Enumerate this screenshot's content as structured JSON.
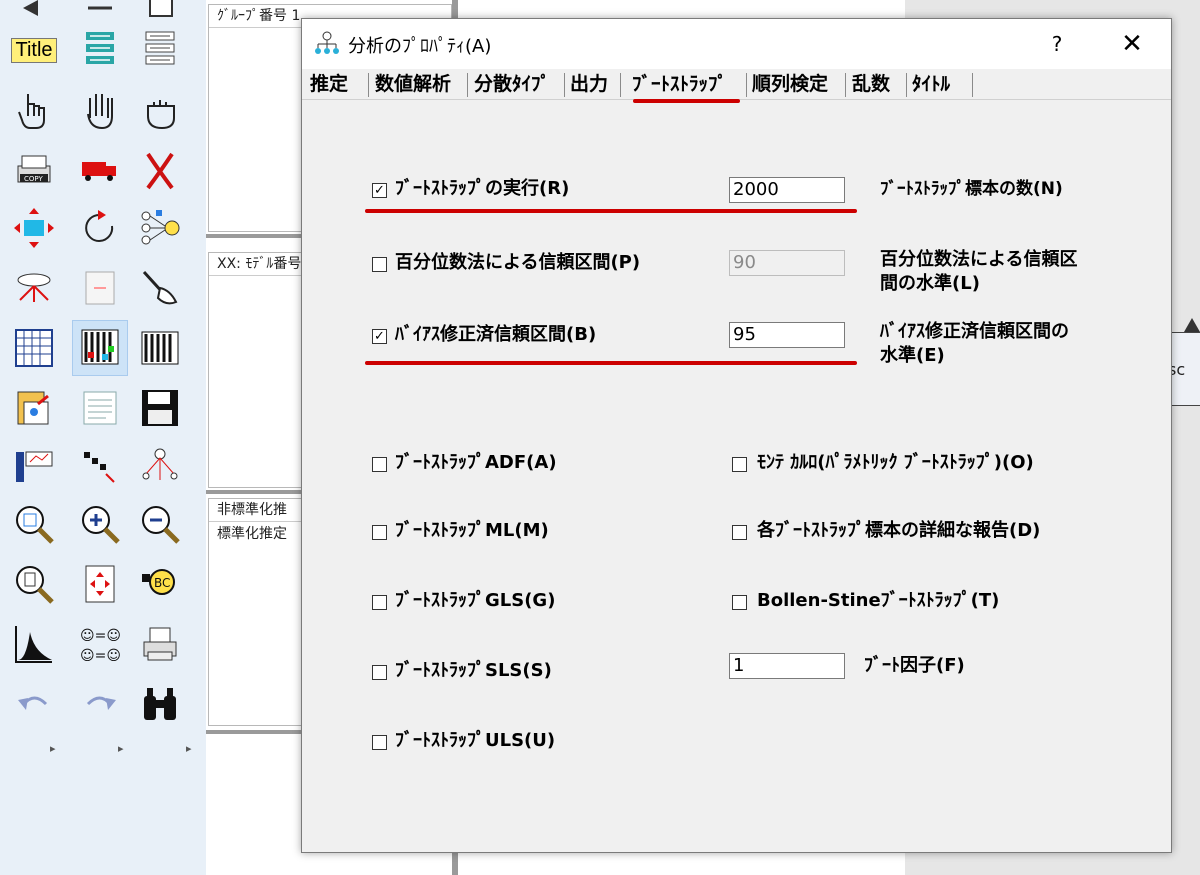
{
  "toolbar": {
    "title_icon_text": "Title",
    "arrows": [
      "▸",
      "▸",
      "▸"
    ]
  },
  "panels": {
    "groups_title": "ｸﾞﾙｰﾌﾟ番号 1",
    "models_title": "XX: ﾓﾃﾞﾙ番号",
    "estimates_title": "非標準化推",
    "estimates_line2": "標準化推定"
  },
  "right_shape_text": "sc",
  "dialog": {
    "title": "分析のﾌﾟﾛﾊﾟﾃｨ(A)",
    "help_label": "?",
    "close_label": "✕",
    "tabs": [
      {
        "label": "推定"
      },
      {
        "label": "数値解析"
      },
      {
        "label": "分散ﾀｲﾌﾟ"
      },
      {
        "label": "出力"
      },
      {
        "label": "ﾌﾞｰﾄｽﾄﾗｯﾌﾟ",
        "active": true
      },
      {
        "label": "順列検定"
      },
      {
        "label": "乱数"
      },
      {
        "label": "ﾀｲﾄﾙ"
      }
    ],
    "bootstrap": {
      "perform": {
        "label": "ﾌﾞｰﾄｽﾄﾗｯﾌﾟの実行(R)",
        "checked": true
      },
      "samples": {
        "value": "2000",
        "label": "ﾌﾞｰﾄｽﾄﾗｯﾌﾟ標本の数(N)"
      },
      "percentile": {
        "label": "百分位数法による信頼区間(P)",
        "checked": false
      },
      "percentile_level": {
        "value": "90",
        "label_line1": "百分位数法による信頼区",
        "label_line2": "間の水準(L)",
        "enabled": false
      },
      "bias": {
        "label": "ﾊﾞｲｱｽ修正済信頼区間(B)",
        "checked": true
      },
      "bias_level": {
        "value": "95",
        "label_line1": "ﾊﾞｲｱｽ修正済信頼区間の",
        "label_line2": "水準(E)"
      },
      "adf": {
        "label": "ﾌﾞｰﾄｽﾄﾗｯﾌﾟADF(A)",
        "checked": false
      },
      "ml": {
        "label": "ﾌﾞｰﾄｽﾄﾗｯﾌﾟML(M)",
        "checked": false
      },
      "gls": {
        "label": "ﾌﾞｰﾄｽﾄﾗｯﾌﾟGLS(G)",
        "checked": false
      },
      "sls": {
        "label": "ﾌﾞｰﾄｽﾄﾗｯﾌﾟSLS(S)",
        "checked": false
      },
      "uls": {
        "label": "ﾌﾞｰﾄｽﾄﾗｯﾌﾟULS(U)",
        "checked": false
      },
      "montecarlo": {
        "label": "ﾓﾝﾃ ｶﾙﾛ(ﾊﾟﾗﾒﾄﾘｯｸ ﾌﾞｰﾄｽﾄﾗｯﾌﾟ)(O)",
        "checked": false
      },
      "detail": {
        "label": "各ﾌﾞｰﾄｽﾄﾗｯﾌﾟ標本の詳細な報告(D)",
        "checked": false
      },
      "bollen": {
        "label": "Bollen-Stineﾌﾞｰﾄｽﾄﾗｯﾌﾟ(T)",
        "checked": false
      },
      "boot_factor": {
        "value": "1",
        "label": "ﾌﾞｰﾄ因子(F)"
      }
    },
    "accent_color": "#cc0000"
  }
}
